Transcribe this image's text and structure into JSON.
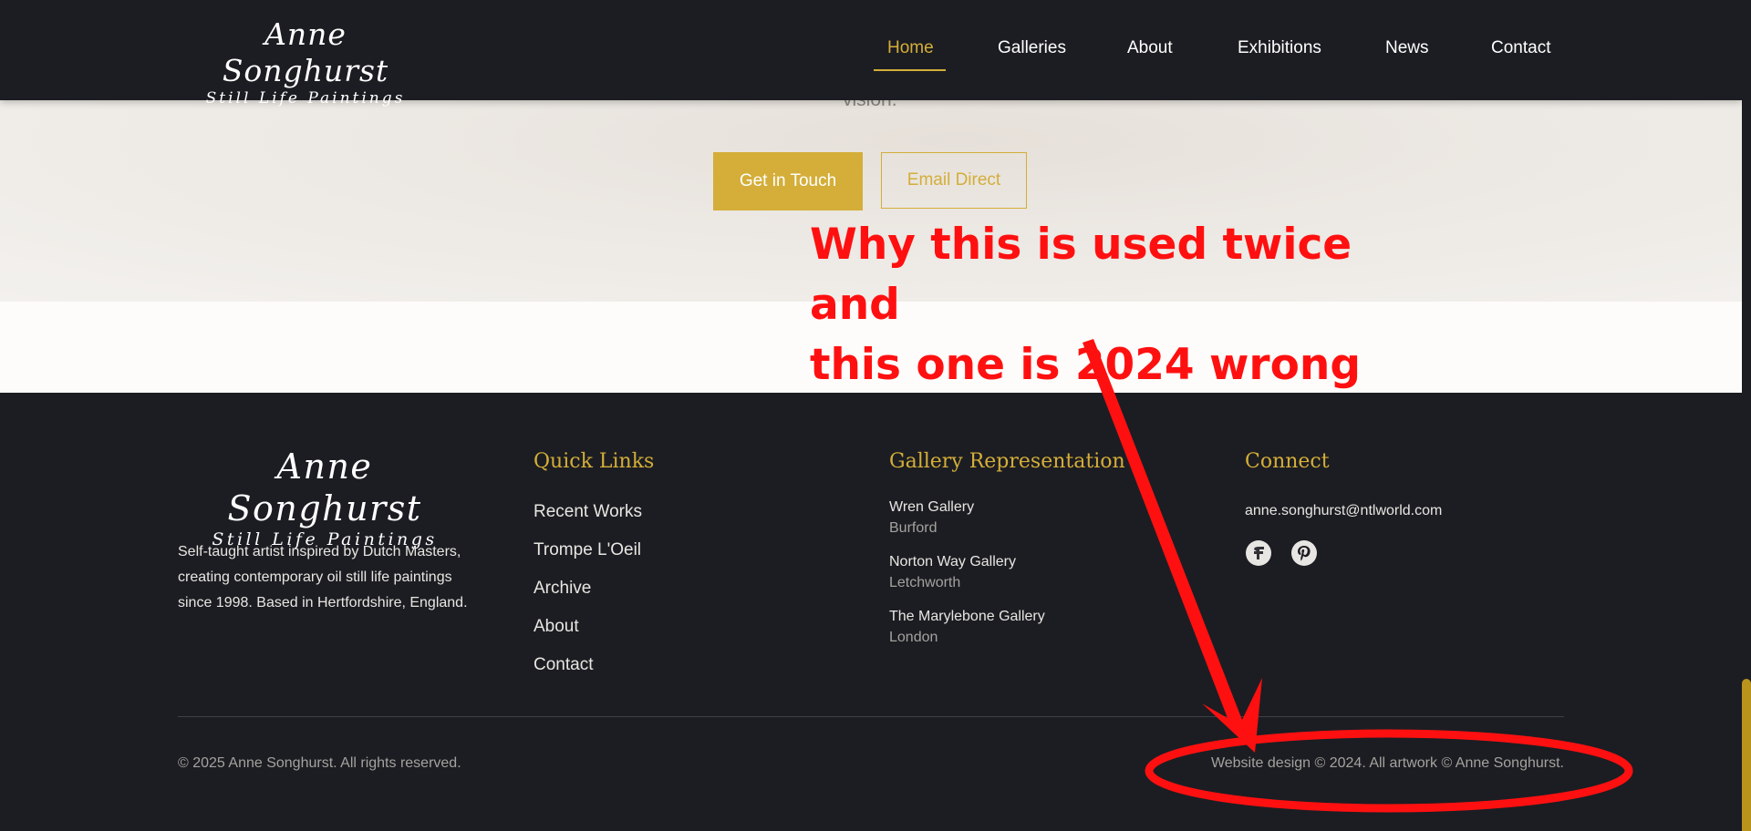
{
  "header": {
    "logo_name": "Anne Songhurst",
    "logo_sub": "Still Life Paintings",
    "nav": [
      {
        "label": "Home",
        "active": true
      },
      {
        "label": "Galleries"
      },
      {
        "label": "About"
      },
      {
        "label": "Exhibitions"
      },
      {
        "label": "News"
      },
      {
        "label": "Contact"
      }
    ]
  },
  "cta": {
    "text_tail": "vision.",
    "primary_label": "Get in Touch",
    "secondary_label": "Email Direct"
  },
  "footer": {
    "logo_name": "Anne Songhurst",
    "logo_sub": "Still Life Paintings",
    "description": "Self-taught artist inspired by Dutch Masters, creating contemporary oil still life paintings since 1998. Based in Hertfordshire, England.",
    "quick_links_heading": "Quick Links",
    "quick_links": [
      "Recent Works",
      "Trompe L'Oeil",
      "Archive",
      "About",
      "Contact"
    ],
    "galleries_heading": "Gallery Representation",
    "galleries": [
      {
        "name": "Wren Gallery",
        "location": "Burford"
      },
      {
        "name": "Norton Way Gallery",
        "location": "Letchworth"
      },
      {
        "name": "The Marylebone Gallery",
        "location": "London"
      }
    ],
    "connect_heading": "Connect",
    "email": "anne.songhurst@ntlworld.com",
    "social_icons": [
      "facebook-icon",
      "pinterest-icon"
    ],
    "copyright": "© 2025 Anne Songhurst. All rights reserved.",
    "credit": "Website design © 2024. All artwork © Anne Songhurst."
  },
  "annotation": {
    "line1": "Why this is used twice and",
    "line2": "this one is 2024 wrong"
  },
  "colors": {
    "accent_gold": "#d4ae39",
    "dark_bg": "#1c1d22",
    "annotation_red": "#ff1010"
  }
}
